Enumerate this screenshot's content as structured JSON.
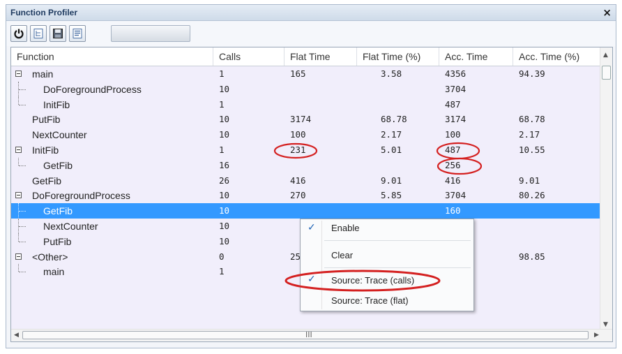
{
  "window": {
    "title": "Function Profiler",
    "close_glyph": "×"
  },
  "toolbar": {
    "buttons": [
      "power-icon",
      "tree-icon",
      "save-icon",
      "list-icon"
    ]
  },
  "columns": [
    "Function",
    "Calls",
    "Flat Time",
    "Flat Time (%)",
    "Acc. Time",
    "Acc. Time (%)"
  ],
  "rows": [
    {
      "name": "main",
      "calls": "1",
      "flat": "165",
      "flat_pct": "3.58",
      "acc": "4356",
      "acc_pct": "94.39"
    },
    {
      "name": "DoForegroundProcess",
      "calls": "10",
      "flat": "",
      "flat_pct": "",
      "acc": "3704",
      "acc_pct": ""
    },
    {
      "name": "InitFib",
      "calls": "1",
      "flat": "",
      "flat_pct": "",
      "acc": "487",
      "acc_pct": ""
    },
    {
      "name": "PutFib",
      "calls": "10",
      "flat": "3174",
      "flat_pct": "68.78",
      "acc": "3174",
      "acc_pct": "68.78"
    },
    {
      "name": "NextCounter",
      "calls": "10",
      "flat": "100",
      "flat_pct": "2.17",
      "acc": "100",
      "acc_pct": "2.17"
    },
    {
      "name": "InitFib",
      "calls": "1",
      "flat": "231",
      "flat_pct": "5.01",
      "acc": "487",
      "acc_pct": "10.55"
    },
    {
      "name": "GetFib",
      "calls": "16",
      "flat": "",
      "flat_pct": "",
      "acc": "256",
      "acc_pct": ""
    },
    {
      "name": "GetFib",
      "calls": "26",
      "flat": "416",
      "flat_pct": "9.01",
      "acc": "416",
      "acc_pct": "9.01"
    },
    {
      "name": "DoForegroundProcess",
      "calls": "10",
      "flat": "270",
      "flat_pct": "5.85",
      "acc": "3704",
      "acc_pct": "80.26"
    },
    {
      "name": "GetFib",
      "calls": "10",
      "flat": "",
      "flat_pct": "",
      "acc": "160",
      "acc_pct": ""
    },
    {
      "name": "NextCounter",
      "calls": "10",
      "flat": "",
      "flat_pct": "",
      "acc": "",
      "acc_pct": ""
    },
    {
      "name": "PutFib",
      "calls": "10",
      "flat": "",
      "flat_pct": "",
      "acc": "",
      "acc_pct": ""
    },
    {
      "name": "<Other>",
      "calls": "0",
      "flat": "25",
      "flat_pct": "",
      "acc": "",
      "acc_pct": "98.85"
    },
    {
      "name": "main",
      "calls": "1",
      "flat": "",
      "flat_pct": "",
      "acc": "",
      "acc_pct": ""
    }
  ],
  "context_menu": {
    "items": [
      {
        "label": "Enable",
        "checked": true
      },
      {
        "label": "Clear",
        "checked": false
      },
      {
        "label": "Source: Trace (calls)",
        "checked": true
      },
      {
        "label": "Source: Trace (flat)",
        "checked": false
      }
    ],
    "check_glyph": "✓"
  },
  "scrollbar": {
    "grip": "III",
    "left_arrow": "◀",
    "right_arrow": "▶",
    "up_arrow": "▲",
    "down_arrow": "▼"
  },
  "annotation_color": "#d42020",
  "selection_color": "#3399ff"
}
